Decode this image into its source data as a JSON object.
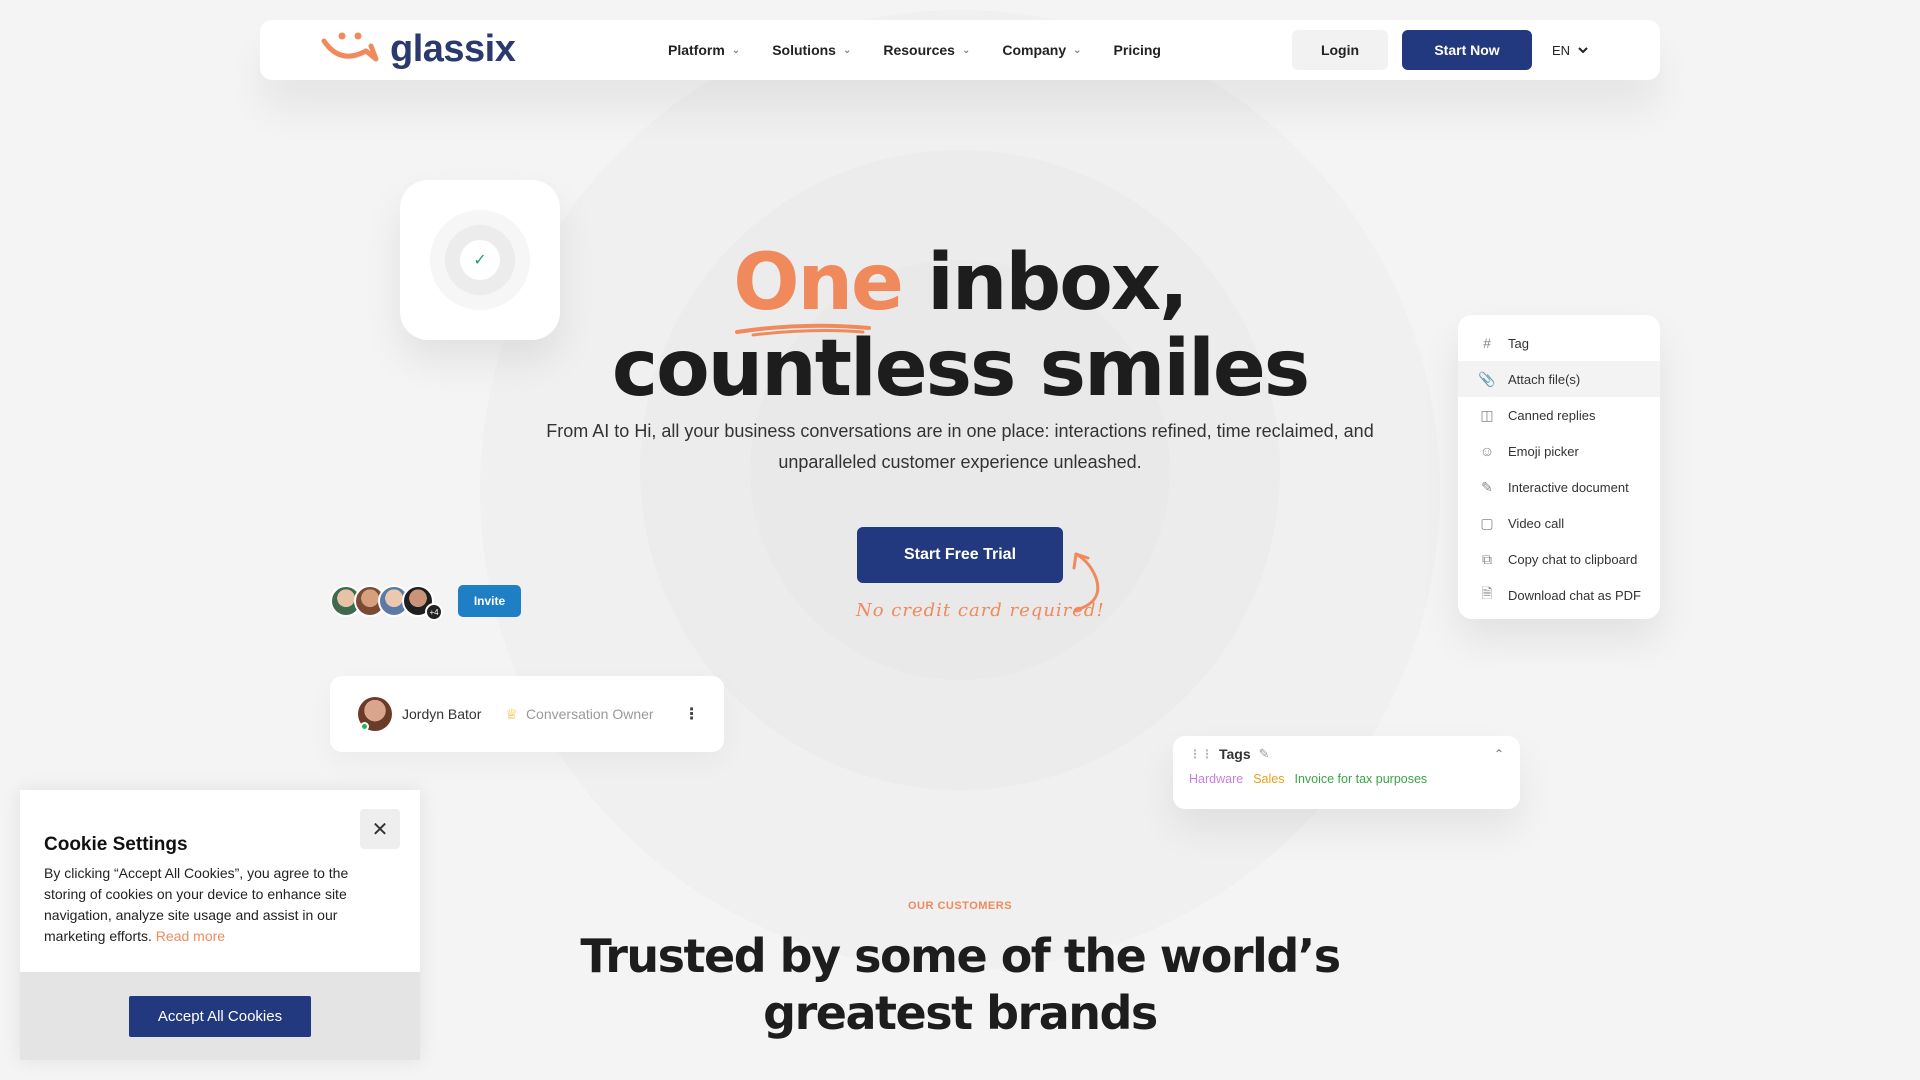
{
  "brand": {
    "name": "glassix",
    "color": "#2a3a6e",
    "accent": "#f08a5d"
  },
  "nav": {
    "items": [
      {
        "label": "Platform",
        "has_dropdown": true
      },
      {
        "label": "Solutions",
        "has_dropdown": true
      },
      {
        "label": "Resources",
        "has_dropdown": true
      },
      {
        "label": "Company",
        "has_dropdown": true
      },
      {
        "label": "Pricing",
        "has_dropdown": false
      }
    ],
    "login": "Login",
    "start_now": "Start Now",
    "language": "EN"
  },
  "hero": {
    "title_accent": "One",
    "title_rest": "inbox,",
    "title_line2": "countless smiles",
    "subtitle": "From AI to Hi, all your business conversations are in one place: interactions refined, time reclaimed, and unparalleled customer experience unleashed.",
    "cta": "Start Free Trial",
    "note": "No credit card required!"
  },
  "team": {
    "more_count": "+4",
    "invite": "Invite"
  },
  "owner_card": {
    "name": "Jordyn Bator",
    "role": "Conversation Owner"
  },
  "actions_menu": {
    "items": [
      {
        "label": "Tag",
        "icon": "hash-icon",
        "active": false
      },
      {
        "label": "Attach file(s)",
        "icon": "paperclip-icon",
        "active": true
      },
      {
        "label": "Canned replies",
        "icon": "chat-bubble-icon",
        "active": false
      },
      {
        "label": "Emoji picker",
        "icon": "smiley-icon",
        "active": false
      },
      {
        "label": "Interactive document",
        "icon": "edit-document-icon",
        "active": false
      },
      {
        "label": "Video call",
        "icon": "video-camera-icon",
        "active": false
      },
      {
        "label": "Copy chat to clipboard",
        "icon": "copy-icon",
        "active": false
      },
      {
        "label": "Download chat as PDF",
        "icon": "pdf-file-icon",
        "active": false
      }
    ]
  },
  "tags_card": {
    "title": "Tags",
    "tags": [
      {
        "label": "Hardware",
        "color": "#c77dde"
      },
      {
        "label": "Sales",
        "color": "#e8a317"
      },
      {
        "label": "Invoice for tax purposes",
        "color": "#3aa24a"
      }
    ]
  },
  "customers": {
    "eyebrow": "OUR CUSTOMERS",
    "heading_line1": "Trusted by some of the world’s",
    "heading_line2": "greatest brands"
  },
  "cookie": {
    "title": "Cookie Settings",
    "text": "By clicking “Accept All Cookies”, you agree to the storing of cookies on your device to enhance site navigation, analyze site usage and assist in our marketing efforts.",
    "read_more": "Read more",
    "accept": "Accept All Cookies"
  }
}
